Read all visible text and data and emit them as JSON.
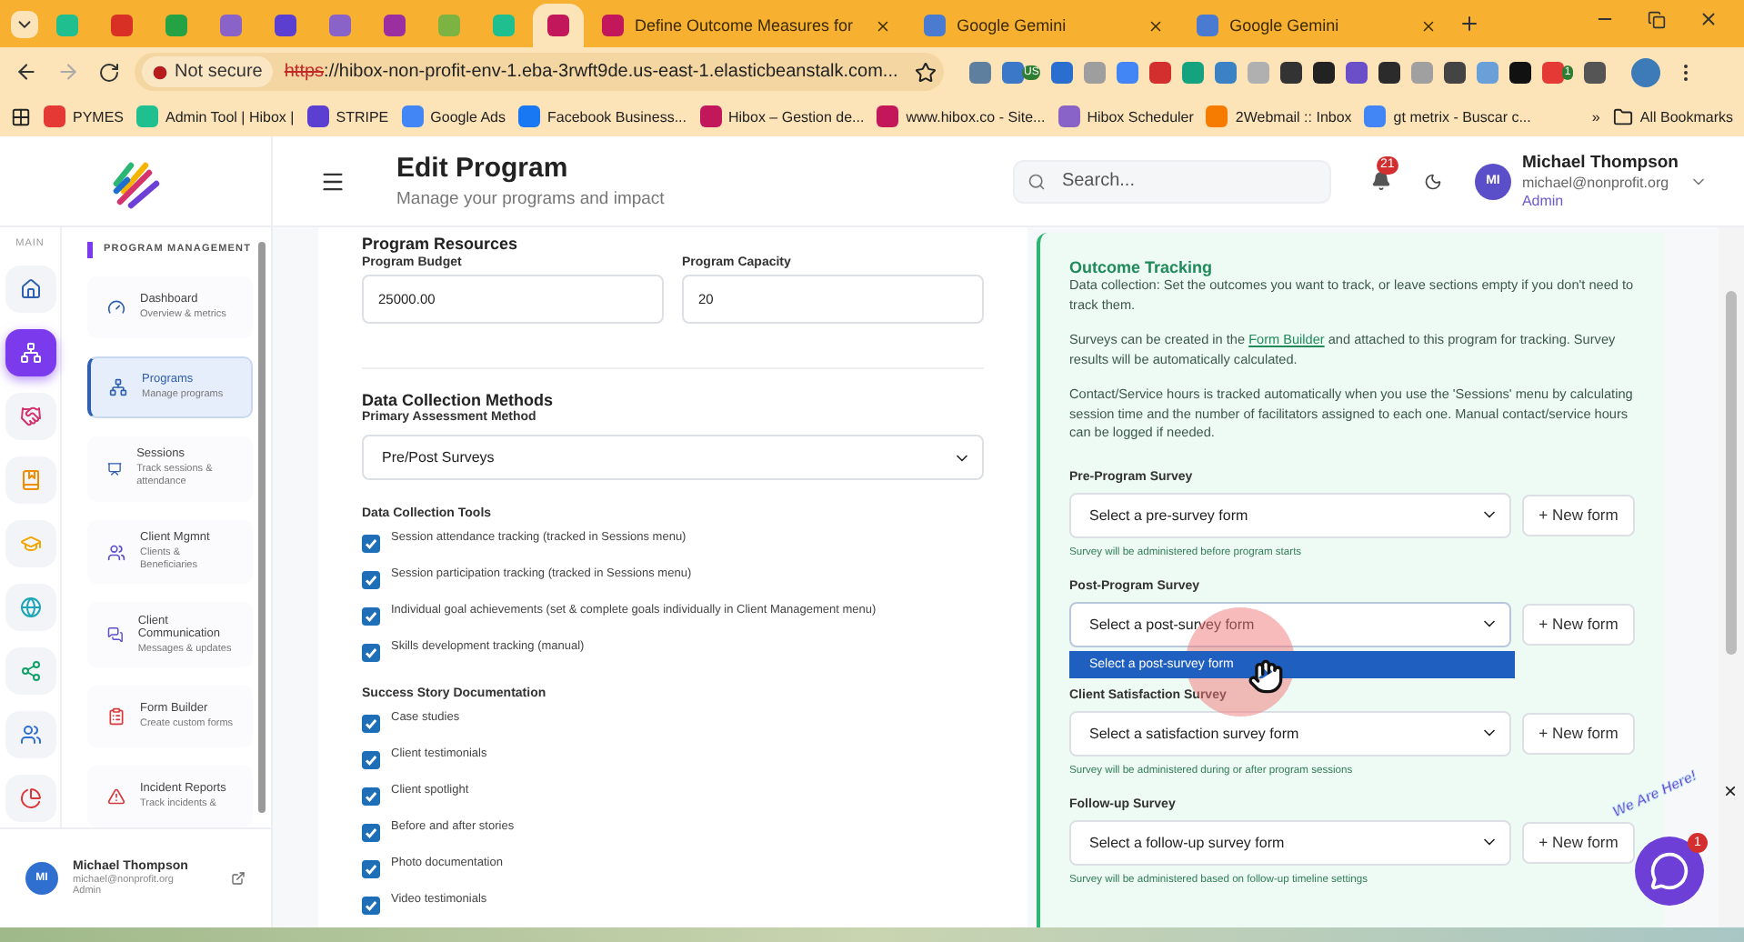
{
  "browser": {
    "tabs": [
      {
        "kind": "pinned",
        "color": "#1fbf8f",
        "selected": false
      },
      {
        "kind": "pinned",
        "color": "#d93025",
        "selected": false
      },
      {
        "kind": "pinned",
        "color": "#25a244",
        "selected": false
      },
      {
        "kind": "pinned",
        "color": "#8a63c9",
        "selected": false
      },
      {
        "kind": "pinned",
        "color": "#5b3fd0",
        "selected": false
      },
      {
        "kind": "pinned",
        "color": "#8a63c9",
        "selected": false
      },
      {
        "kind": "pinned",
        "color": "#9c2fa0",
        "selected": false
      },
      {
        "kind": "pinned",
        "color": "#7cb342",
        "selected": false
      },
      {
        "kind": "pinned",
        "color": "#1fbf8f",
        "selected": false
      },
      {
        "kind": "pinned",
        "color": "#c2185b",
        "selected": true
      },
      {
        "kind": "titled",
        "color": "#c2185b",
        "title": "Define Outcome Measures for",
        "selected": false
      },
      {
        "kind": "titled",
        "color": "#4a7bd0",
        "title": "Google Gemini",
        "selected": false
      },
      {
        "kind": "titled",
        "color": "#4a7bd0",
        "title": "Google Gemini",
        "selected": false
      }
    ],
    "security": "Not secure",
    "url_scheme": "https",
    "url_rest": "://hibox-non-profit-env-1.eba-3rwft9de.us-east-1.elasticbeanstalk.com...",
    "extensions": [
      {
        "color": "#5f7f9e"
      },
      {
        "color": "#3c78c8",
        "badge": "US"
      },
      {
        "color": "#2a6fd0"
      },
      {
        "color": "#9e9e9e"
      },
      {
        "color": "#4285f4"
      },
      {
        "color": "#d32f2f"
      },
      {
        "color": "#15a37f"
      },
      {
        "color": "#3b82c4"
      },
      {
        "color": "#b0b0b0"
      },
      {
        "color": "#333333"
      },
      {
        "color": "#222222"
      },
      {
        "color": "#6a4fc9"
      },
      {
        "color": "#2b2b2b"
      },
      {
        "color": "#a0a0a0"
      },
      {
        "color": "#444444"
      },
      {
        "color": "#6aa0d8"
      },
      {
        "color": "#111111"
      },
      {
        "color": "#e53935",
        "badge": "1"
      },
      {
        "color": "#555555"
      }
    ],
    "bookmarks": [
      {
        "label": "PYMES",
        "color": "#e53935"
      },
      {
        "label": "Admin Tool | Hibox |",
        "color": "#1fbf8f"
      },
      {
        "label": "STRIPE",
        "color": "#5b3fd0"
      },
      {
        "label": "Google Ads",
        "color": "#4285f4"
      },
      {
        "label": "Facebook Business...",
        "color": "#1877f2"
      },
      {
        "label": "Hibox – Gestion de...",
        "color": "#c2185b"
      },
      {
        "label": "www.hibox.co - Site...",
        "color": "#c2185b"
      },
      {
        "label": "Hibox Scheduler",
        "color": "#8a63c9"
      },
      {
        "label": "2Webmail :: Inbox",
        "color": "#f57c00"
      },
      {
        "label": "gt metrix - Buscar c...",
        "color": "#4285f4"
      }
    ],
    "more_bookmarks": "»",
    "all_bookmarks": "All Bookmarks"
  },
  "sidebar": {
    "rail_label": "MAIN",
    "rail": [
      {
        "kind": "home",
        "selected": false
      },
      {
        "kind": "programs",
        "selected": true
      },
      {
        "kind": "handshake",
        "selected": false
      },
      {
        "kind": "book",
        "selected": false
      },
      {
        "kind": "education",
        "selected": false
      },
      {
        "kind": "globe",
        "selected": false
      },
      {
        "kind": "network",
        "selected": false
      },
      {
        "kind": "people",
        "selected": false
      },
      {
        "kind": "chart",
        "selected": false
      }
    ],
    "section": "PROGRAM MANAGEMENT",
    "nav": [
      {
        "kind": "dashboard",
        "title": "Dashboard",
        "subtitle": "Overview & metrics",
        "selected": false
      },
      {
        "kind": "programs",
        "title": "Programs",
        "subtitle": "Manage programs",
        "selected": true
      },
      {
        "kind": "sessions",
        "title": "Sessions",
        "subtitle": "Track sessions & attendance",
        "selected": false
      },
      {
        "kind": "clients",
        "title": "Client Mgmnt",
        "subtitle": "Clients & Beneficiaries",
        "selected": false
      },
      {
        "kind": "communication",
        "title": "Client Communication",
        "subtitle": "Messages & updates",
        "selected": false
      },
      {
        "kind": "forms",
        "title": "Form Builder",
        "subtitle": "Create custom forms",
        "selected": false
      },
      {
        "kind": "incidents",
        "title": "Incident Reports",
        "subtitle": "Track incidents &",
        "selected": false
      }
    ],
    "user": {
      "initials": "MI",
      "name": "Michael Thompson",
      "email": "michael@nonprofit.org",
      "role": "Admin"
    }
  },
  "header": {
    "title": "Edit Program",
    "subtitle": "Manage your programs and impact",
    "search_placeholder": "Search...",
    "notifications": "21",
    "user": {
      "initials": "MI",
      "name": "Michael Thompson",
      "email": "michael@nonprofit.org",
      "role": "Admin"
    }
  },
  "form": {
    "resources_title": "Program Resources",
    "fields": [
      {
        "label": "Program Budget",
        "value": "25000.00"
      },
      {
        "label": "Program Capacity",
        "value": "20"
      }
    ],
    "methods_title": "Data Collection Methods",
    "assessment_label": "Primary Assessment Method",
    "assessment_value": "Pre/Post Surveys",
    "groups": [
      {
        "title": "Data Collection Tools",
        "items": [
          {
            "label": "Session attendance tracking (tracked in Sessions menu)",
            "checked": true
          },
          {
            "label": "Session participation tracking (tracked in Sessions menu)",
            "checked": true
          },
          {
            "label": "Individual goal achievements (set & complete goals individually in Client Management menu)",
            "checked": true
          },
          {
            "label": "Skills development tracking (manual)",
            "checked": true
          }
        ]
      },
      {
        "title": "Success Story Documentation",
        "items": [
          {
            "label": "Case studies",
            "checked": true
          },
          {
            "label": "Client testimonials",
            "checked": true
          },
          {
            "label": "Client spotlight",
            "checked": true
          },
          {
            "label": "Before and after stories",
            "checked": true
          },
          {
            "label": "Photo documentation",
            "checked": true
          },
          {
            "label": "Video testimonials",
            "checked": true
          }
        ]
      }
    ]
  },
  "outcome": {
    "title": "Outcome Tracking",
    "intro": "Data collection: Set the outcomes you want to track, or leave sections empty if you don't need to track them.",
    "surveys_before": "Surveys can be created in the ",
    "surveys_link": "Form Builder",
    "surveys_after": " and attached to this program for tracking. Survey results will be automatically calculated.",
    "hours": "Contact/Service hours is tracked automatically when you use the 'Sessions' menu by calculating session time and the number of facilitators assigned to each one. Manual contact/service hours can be logged if needed.",
    "surveys": [
      {
        "label": "Pre-Program Survey",
        "value": "Select a pre-survey form",
        "button": "+ New form",
        "hint": "Survey will be administered before program starts",
        "expanded": false
      },
      {
        "label": "Post-Program Survey",
        "value": "Select a post-survey form",
        "button": "+ New form",
        "expanded": true,
        "option": "Select a post-survey form"
      },
      {
        "label": "Client Satisfaction Survey",
        "value": "Select a satisfaction survey form",
        "button": "+ New form",
        "hint": "Survey will be administered during or after program sessions",
        "expanded": false
      },
      {
        "label": "Follow-up Survey",
        "value": "Select a follow-up survey form",
        "button": "+ New form",
        "hint": "Survey will be administered based on follow-up timeline settings",
        "expanded": false
      }
    ]
  },
  "chat": {
    "tagline": "We Are Here!",
    "badge": "1",
    "close": "×"
  }
}
